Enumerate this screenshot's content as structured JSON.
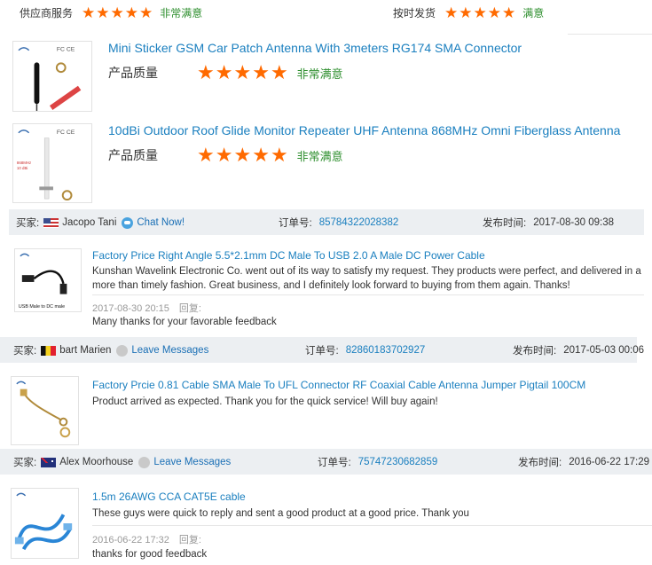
{
  "top": {
    "supplier_label": "供应商服务",
    "supplier_value": "非常满意",
    "shipping_label": "按时发货",
    "shipping_value": "满意",
    "star_color": "#ff6a00"
  },
  "products": [
    {
      "title": "Mini Sticker GSM Car Patch Antenna With 3meters RG174 SMA Connector",
      "quality_label": "产品质量",
      "quality_value": "非常满意"
    },
    {
      "title": "10dBi Outdoor Roof Glide Monitor Repeater UHF Antenna 868MHz Omni Fiberglass Antenna",
      "quality_label": "产品质量",
      "quality_value": "非常满意"
    }
  ],
  "labels": {
    "buyer": "买家:",
    "order": "订单号:",
    "published": "发布时间:",
    "reply": "回复:"
  },
  "feedback": [
    {
      "buyer_name": "Jacopo Tani",
      "flag": "us-flag-icon",
      "contact_action": "Chat Now!",
      "order_number": "85784322028382",
      "published": "2017-08-30 09:38",
      "product_title": "Factory Price Right Angle 5.5*2.1mm DC Male To USB 2.0 A Male DC Power Cable",
      "thumb_caption": "USB Male to DC male",
      "review_text": "Kunshan Wavelink Electronic Co. went out of its way to satisfy my request. They products were perfect, and delivered in a more than timely fashion. Great business, and I definitely look forward to buying from them again.   Thanks!",
      "reply_date": "2017-08-30 20:15",
      "reply_text": "Many thanks for your favorable feedback"
    },
    {
      "buyer_name": "bart Marien",
      "flag": "be-flag-icon",
      "contact_action": "Leave Messages",
      "order_number": "82860183702927",
      "published": "2017-05-03 00:06",
      "product_title": "Factory Prcie 0.81 Cable SMA Male To UFL Connector RF Coaxial Cable Antenna Jumper Pigtail 100CM",
      "review_text": "Product arrived as expected. Thank you for the quick service! Will buy again!"
    },
    {
      "buyer_name": "Alex Moorhouse",
      "flag": "au-flag-icon",
      "contact_action": "Leave Messages",
      "order_number": "75747230682859",
      "published": "2016-06-22 17:29",
      "product_title": "1.5m 26AWG CCA CAT5E cable",
      "review_text": "These guys were quick to reply and sent a good product at a good price. Thank you",
      "reply_date": "2016-06-22 17:32",
      "reply_text": "thanks for good feedback"
    }
  ]
}
